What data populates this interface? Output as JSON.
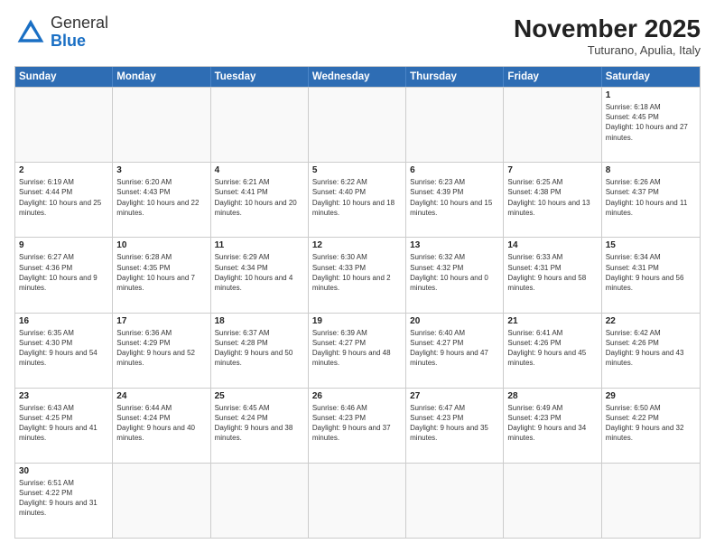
{
  "header": {
    "logo_general": "General",
    "logo_blue": "Blue",
    "month_title": "November 2025",
    "subtitle": "Tuturano, Apulia, Italy"
  },
  "days_of_week": [
    "Sunday",
    "Monday",
    "Tuesday",
    "Wednesday",
    "Thursday",
    "Friday",
    "Saturday"
  ],
  "weeks": [
    [
      {
        "day": "",
        "info": ""
      },
      {
        "day": "",
        "info": ""
      },
      {
        "day": "",
        "info": ""
      },
      {
        "day": "",
        "info": ""
      },
      {
        "day": "",
        "info": ""
      },
      {
        "day": "",
        "info": ""
      },
      {
        "day": "1",
        "info": "Sunrise: 6:18 AM\nSunset: 4:45 PM\nDaylight: 10 hours and 27 minutes."
      }
    ],
    [
      {
        "day": "2",
        "info": "Sunrise: 6:19 AM\nSunset: 4:44 PM\nDaylight: 10 hours and 25 minutes."
      },
      {
        "day": "3",
        "info": "Sunrise: 6:20 AM\nSunset: 4:43 PM\nDaylight: 10 hours and 22 minutes."
      },
      {
        "day": "4",
        "info": "Sunrise: 6:21 AM\nSunset: 4:41 PM\nDaylight: 10 hours and 20 minutes."
      },
      {
        "day": "5",
        "info": "Sunrise: 6:22 AM\nSunset: 4:40 PM\nDaylight: 10 hours and 18 minutes."
      },
      {
        "day": "6",
        "info": "Sunrise: 6:23 AM\nSunset: 4:39 PM\nDaylight: 10 hours and 15 minutes."
      },
      {
        "day": "7",
        "info": "Sunrise: 6:25 AM\nSunset: 4:38 PM\nDaylight: 10 hours and 13 minutes."
      },
      {
        "day": "8",
        "info": "Sunrise: 6:26 AM\nSunset: 4:37 PM\nDaylight: 10 hours and 11 minutes."
      }
    ],
    [
      {
        "day": "9",
        "info": "Sunrise: 6:27 AM\nSunset: 4:36 PM\nDaylight: 10 hours and 9 minutes."
      },
      {
        "day": "10",
        "info": "Sunrise: 6:28 AM\nSunset: 4:35 PM\nDaylight: 10 hours and 7 minutes."
      },
      {
        "day": "11",
        "info": "Sunrise: 6:29 AM\nSunset: 4:34 PM\nDaylight: 10 hours and 4 minutes."
      },
      {
        "day": "12",
        "info": "Sunrise: 6:30 AM\nSunset: 4:33 PM\nDaylight: 10 hours and 2 minutes."
      },
      {
        "day": "13",
        "info": "Sunrise: 6:32 AM\nSunset: 4:32 PM\nDaylight: 10 hours and 0 minutes."
      },
      {
        "day": "14",
        "info": "Sunrise: 6:33 AM\nSunset: 4:31 PM\nDaylight: 9 hours and 58 minutes."
      },
      {
        "day": "15",
        "info": "Sunrise: 6:34 AM\nSunset: 4:31 PM\nDaylight: 9 hours and 56 minutes."
      }
    ],
    [
      {
        "day": "16",
        "info": "Sunrise: 6:35 AM\nSunset: 4:30 PM\nDaylight: 9 hours and 54 minutes."
      },
      {
        "day": "17",
        "info": "Sunrise: 6:36 AM\nSunset: 4:29 PM\nDaylight: 9 hours and 52 minutes."
      },
      {
        "day": "18",
        "info": "Sunrise: 6:37 AM\nSunset: 4:28 PM\nDaylight: 9 hours and 50 minutes."
      },
      {
        "day": "19",
        "info": "Sunrise: 6:39 AM\nSunset: 4:27 PM\nDaylight: 9 hours and 48 minutes."
      },
      {
        "day": "20",
        "info": "Sunrise: 6:40 AM\nSunset: 4:27 PM\nDaylight: 9 hours and 47 minutes."
      },
      {
        "day": "21",
        "info": "Sunrise: 6:41 AM\nSunset: 4:26 PM\nDaylight: 9 hours and 45 minutes."
      },
      {
        "day": "22",
        "info": "Sunrise: 6:42 AM\nSunset: 4:26 PM\nDaylight: 9 hours and 43 minutes."
      }
    ],
    [
      {
        "day": "23",
        "info": "Sunrise: 6:43 AM\nSunset: 4:25 PM\nDaylight: 9 hours and 41 minutes."
      },
      {
        "day": "24",
        "info": "Sunrise: 6:44 AM\nSunset: 4:24 PM\nDaylight: 9 hours and 40 minutes."
      },
      {
        "day": "25",
        "info": "Sunrise: 6:45 AM\nSunset: 4:24 PM\nDaylight: 9 hours and 38 minutes."
      },
      {
        "day": "26",
        "info": "Sunrise: 6:46 AM\nSunset: 4:23 PM\nDaylight: 9 hours and 37 minutes."
      },
      {
        "day": "27",
        "info": "Sunrise: 6:47 AM\nSunset: 4:23 PM\nDaylight: 9 hours and 35 minutes."
      },
      {
        "day": "28",
        "info": "Sunrise: 6:49 AM\nSunset: 4:23 PM\nDaylight: 9 hours and 34 minutes."
      },
      {
        "day": "29",
        "info": "Sunrise: 6:50 AM\nSunset: 4:22 PM\nDaylight: 9 hours and 32 minutes."
      }
    ],
    [
      {
        "day": "30",
        "info": "Sunrise: 6:51 AM\nSunset: 4:22 PM\nDaylight: 9 hours and 31 minutes."
      },
      {
        "day": "",
        "info": ""
      },
      {
        "day": "",
        "info": ""
      },
      {
        "day": "",
        "info": ""
      },
      {
        "day": "",
        "info": ""
      },
      {
        "day": "",
        "info": ""
      },
      {
        "day": "",
        "info": ""
      }
    ]
  ]
}
